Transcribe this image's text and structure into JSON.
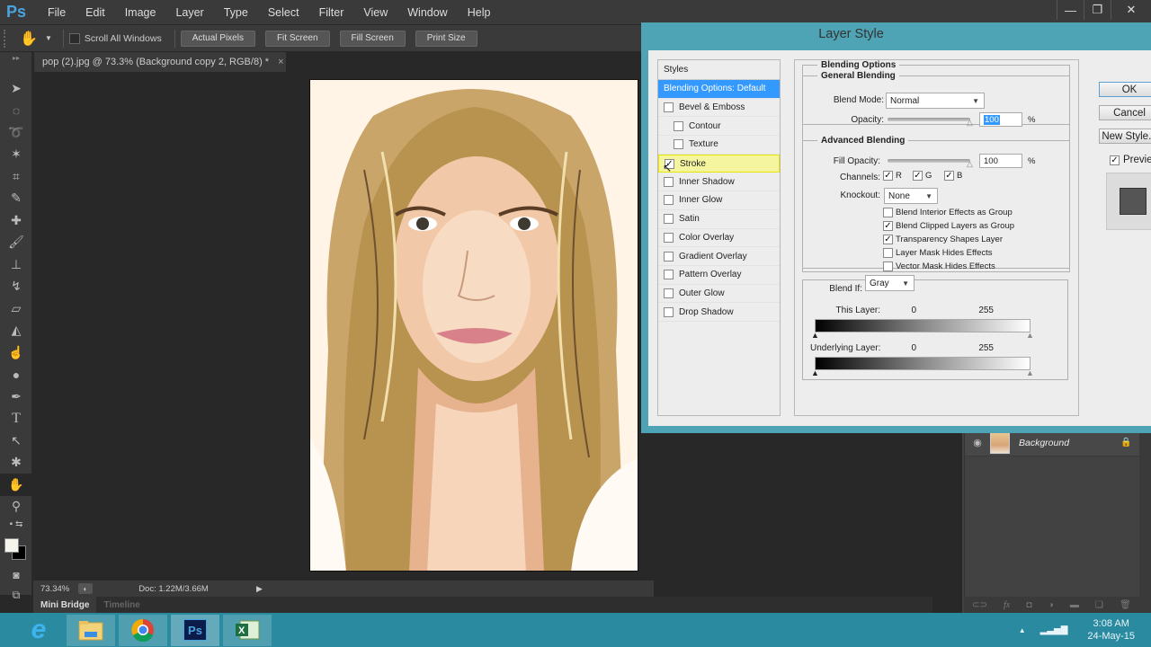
{
  "app": {
    "logo": "Ps",
    "menu": [
      "File",
      "Edit",
      "Image",
      "Layer",
      "Type",
      "Select",
      "Filter",
      "View",
      "Window",
      "Help"
    ],
    "window_controls": {
      "minimize": "—",
      "restore": "❐",
      "close": "✕"
    }
  },
  "options_bar": {
    "tool_icon": "hand-icon",
    "scroll_all_windows": {
      "label": "Scroll All Windows",
      "checked": false
    },
    "buttons": [
      "Actual Pixels",
      "Fit Screen",
      "Fill Screen",
      "Print Size"
    ]
  },
  "document_tab": {
    "title": "pop (2).jpg @ 73.3% (Background copy 2, RGB/8) *",
    "close": "×"
  },
  "toolbox": {
    "tools": [
      "move",
      "marquee",
      "lasso",
      "magic-wand",
      "crop",
      "eyedropper",
      "healing-brush",
      "brush",
      "clone-stamp",
      "history-brush",
      "eraser",
      "paint-bucket",
      "smudge",
      "dodge",
      "pen",
      "type",
      "path-selection",
      "custom-shape",
      "hand",
      "zoom"
    ],
    "active_tool": "hand",
    "foreground_color": "#f5f5ee",
    "background_color": "#000000"
  },
  "status_bar": {
    "zoom": "73.34%",
    "doc": "Doc: 1.22M/3.66M"
  },
  "bottom_tabs": [
    "Mini Bridge",
    "Timeline"
  ],
  "layers_panel": {
    "layers": [
      {
        "name": "Background",
        "visible": true,
        "locked": true
      }
    ]
  },
  "dialog": {
    "title": "Layer Style",
    "styles_header": "Styles",
    "styles": [
      {
        "label": "Blending Options: Default",
        "checkbox": false,
        "selected": true
      },
      {
        "label": "Bevel & Emboss",
        "checkbox": true,
        "checked": false
      },
      {
        "label": "Contour",
        "checkbox": true,
        "checked": false,
        "sub": true
      },
      {
        "label": "Texture",
        "checkbox": true,
        "checked": false,
        "sub": true
      },
      {
        "label": "Stroke",
        "checkbox": true,
        "checked": true,
        "hover": true
      },
      {
        "label": "Inner Shadow",
        "checkbox": true,
        "checked": false
      },
      {
        "label": "Inner Glow",
        "checkbox": true,
        "checked": false
      },
      {
        "label": "Satin",
        "checkbox": true,
        "checked": false
      },
      {
        "label": "Color Overlay",
        "checkbox": true,
        "checked": false
      },
      {
        "label": "Gradient Overlay",
        "checkbox": true,
        "checked": false
      },
      {
        "label": "Pattern Overlay",
        "checkbox": true,
        "checked": false
      },
      {
        "label": "Outer Glow",
        "checkbox": true,
        "checked": false
      },
      {
        "label": "Drop Shadow",
        "checkbox": true,
        "checked": false
      }
    ],
    "blending_options": {
      "title": "Blending Options",
      "general": {
        "title": "General Blending",
        "blend_mode_label": "Blend Mode:",
        "blend_mode": "Normal",
        "opacity_label": "Opacity:",
        "opacity": "100",
        "opacity_unit": "%"
      },
      "advanced": {
        "title": "Advanced Blending",
        "fill_opacity_label": "Fill Opacity:",
        "fill_opacity": "100",
        "fill_unit": "%",
        "channels_label": "Channels:",
        "channels": [
          {
            "label": "R",
            "checked": true
          },
          {
            "label": "G",
            "checked": true
          },
          {
            "label": "B",
            "checked": true
          }
        ],
        "knockout_label": "Knockout:",
        "knockout": "None",
        "options": [
          {
            "label": "Blend Interior Effects as Group",
            "checked": false
          },
          {
            "label": "Blend Clipped Layers as Group",
            "checked": true
          },
          {
            "label": "Transparency Shapes Layer",
            "checked": true
          },
          {
            "label": "Layer Mask Hides Effects",
            "checked": false
          },
          {
            "label": "Vector Mask Hides Effects",
            "checked": false
          }
        ]
      },
      "blend_if": {
        "label": "Blend If:",
        "value": "Gray",
        "this_layer": {
          "label": "This Layer:",
          "min": "0",
          "max": "255"
        },
        "underlying_layer": {
          "label": "Underlying Layer:",
          "min": "0",
          "max": "255"
        }
      }
    },
    "buttons": {
      "ok": "OK",
      "cancel": "Cancel",
      "new_style": "New Style..."
    },
    "preview": {
      "label": "Preview",
      "checked": true
    }
  },
  "taskbar": {
    "apps": [
      "internet-explorer",
      "file-explorer",
      "chrome",
      "photoshop",
      "excel"
    ],
    "active_app": "photoshop",
    "time": "3:08 AM",
    "date": "24-May-15"
  }
}
